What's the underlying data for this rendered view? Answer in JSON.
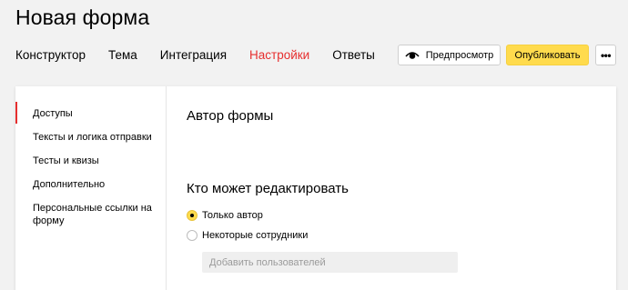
{
  "page_title": "Новая форма",
  "tabs": [
    {
      "label": "Конструктор",
      "active": false
    },
    {
      "label": "Тема",
      "active": false
    },
    {
      "label": "Интеграция",
      "active": false
    },
    {
      "label": "Настройки",
      "active": true
    },
    {
      "label": "Ответы",
      "active": false
    }
  ],
  "toolbar": {
    "preview_label": "Предпросмотр",
    "publish_label": "Опубликовать",
    "more_label": "•••"
  },
  "sidebar": {
    "items": [
      {
        "label": "Доступы",
        "active": true
      },
      {
        "label": "Тексты и логика отправки",
        "active": false
      },
      {
        "label": "Тесты и квизы",
        "active": false
      },
      {
        "label": "Дополнительно",
        "active": false
      },
      {
        "label": "Персональные ссылки на форму",
        "active": false
      }
    ]
  },
  "content": {
    "author_heading": "Автор формы",
    "edit_heading": "Кто может редактировать",
    "radio_options": [
      {
        "label": "Только автор",
        "checked": true
      },
      {
        "label": "Некоторые сотрудники",
        "checked": false
      }
    ],
    "add_users_placeholder": "Добавить пользователей"
  },
  "colors": {
    "accent_red": "#e62e2e",
    "publish_yellow": "#ffdb4d"
  }
}
